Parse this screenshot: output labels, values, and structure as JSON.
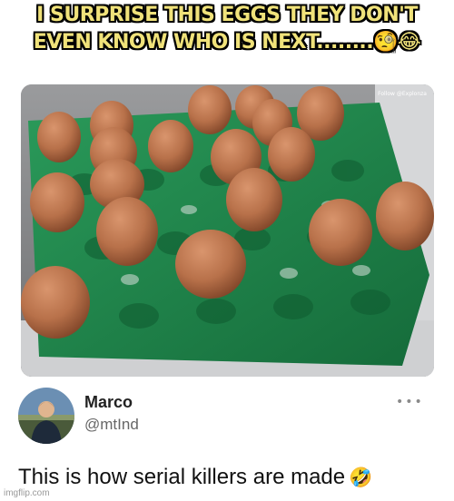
{
  "caption": {
    "line1": "I SURPRISE THIS EGGS THEY DON'T",
    "line2": "EVEN KNOW WHO IS NEXT........🧐😂"
  },
  "photo": {
    "credit": "Follow @Explonza",
    "tray_color": "#1f8a4e",
    "egg_color": "#b8714a"
  },
  "tweet": {
    "name": "Marco",
    "handle": "@mtInd",
    "more_icon": "•••",
    "text": "This is how serial killers are made",
    "emoji": "🤣"
  },
  "watermark": "imgflip.com"
}
